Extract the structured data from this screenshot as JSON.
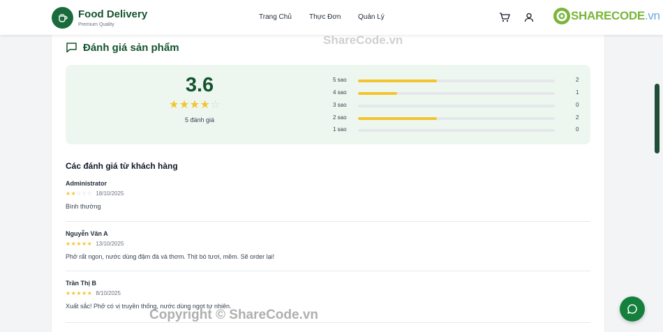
{
  "header": {
    "brand_title": "Food Delivery",
    "brand_subtitle": "Premium Quality",
    "nav": [
      "Trang Chủ",
      "Thực Đơn",
      "Quản Lý"
    ],
    "watermark_brand_a": "SHARE",
    "watermark_brand_b": "CODE",
    "watermark_brand_c": ".vn"
  },
  "section": {
    "title": "Đánh giá sản phẩm"
  },
  "summary": {
    "average": "3.6",
    "average_stars": 4,
    "total_text": "5 đánh giá",
    "distribution": [
      {
        "label": "5 sao",
        "count": "2",
        "fraction": 0.4
      },
      {
        "label": "4 sao",
        "count": "1",
        "fraction": 0.2
      },
      {
        "label": "3 sao",
        "count": "0",
        "fraction": 0
      },
      {
        "label": "2 sao",
        "count": "2",
        "fraction": 0.4
      },
      {
        "label": "1 sao",
        "count": "0",
        "fraction": 0
      }
    ]
  },
  "reviews_title": "Các đánh giá từ khách hàng",
  "reviews": [
    {
      "name": "Administrator",
      "stars": 2,
      "date": "18/10/2025",
      "comment": "Bình thường"
    },
    {
      "name": "Nguyễn Văn A",
      "stars": 5,
      "date": "13/10/2025",
      "comment": "Phở rất ngon, nước dùng đậm đà và thơm. Thịt bò tươi, mềm. Sẽ order lại!"
    },
    {
      "name": "Trần Thị B",
      "stars": 5,
      "date": "8/10/2025",
      "comment": "Xuất sắc! Phở có vị truyền thống, nước dùng ngọt tự nhiên."
    }
  ],
  "watermarks": {
    "top": "ShareCode.vn",
    "bottom": "Copyright © ShareCode.vn"
  },
  "colors": {
    "brand_green": "#14532d",
    "star": "#f4c430",
    "summary_bg": "#edf7ef",
    "chat": "#15803d"
  },
  "icons": [
    "cup-icon",
    "chat-bubble-icon",
    "cart-icon",
    "user-icon",
    "star-icon",
    "chat-icon"
  ]
}
